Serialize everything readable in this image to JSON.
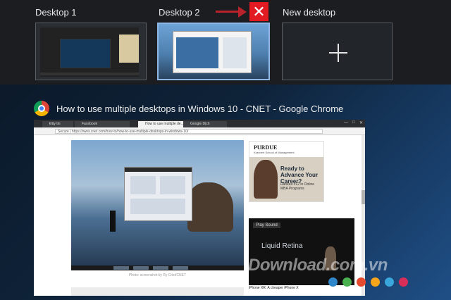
{
  "desktops": [
    {
      "label": "Desktop 1"
    },
    {
      "label": "Desktop 2"
    },
    {
      "label": "New desktop"
    }
  ],
  "close_glyph": "✕",
  "plus_icon": "plus-icon",
  "window": {
    "title": "How to use multiple desktops in Windows 10 - CNET - Google Chrome",
    "icon": "chrome-icon"
  },
  "browser": {
    "tabs": [
      "Đây tin",
      "Facebook",
      "How to use multiple de...",
      "Google Dịch"
    ],
    "url": "Secure | https://www.cnet.com/how-to/how-to-use-multiple-desktops-in-windows-10/",
    "caption": "Photo: screenshot by Ry Crist/CNET",
    "ad1": {
      "brand": "PURDUE",
      "sub": "Krannert School of Management",
      "headline": "Ready to Advance Your Career?",
      "small": "Ranked #12 in Online MBA Programs"
    },
    "ad2": {
      "play": "Play Sound",
      "text": "Liquid Retina",
      "caption": "iPhone XR: A cheaper iPhone X"
    }
  },
  "watermark": "Download.com.vn",
  "colors": {
    "accent_close": "#e21b23",
    "selected_border": "#8fb8e6",
    "watermark_dots": [
      "#2f86c9",
      "#4bb04f",
      "#e64a2e",
      "#f4a51c",
      "#3aa7dc",
      "#d92d5a"
    ]
  }
}
